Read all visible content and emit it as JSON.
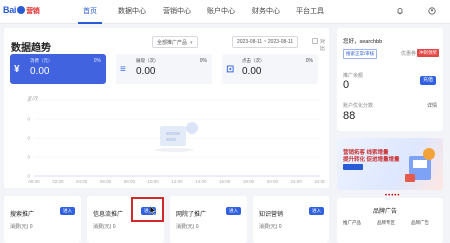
{
  "brand": {
    "logo_text": "Bai",
    "logo_suffix": "营销"
  },
  "nav": {
    "items": [
      "首页",
      "数据中心",
      "营销中心",
      "账户中心",
      "财务中心",
      "平台工具"
    ],
    "active_index": 0
  },
  "trend": {
    "title": "数据趋势",
    "filter": "全部推广产品",
    "date_range": "2023-08-11 ~ 2023-08-11",
    "compare": "对比",
    "metrics": [
      {
        "icon": "¥",
        "label": "消费（元）",
        "value": "0.00",
        "change": "0%",
        "active": true
      },
      {
        "icon": "≡",
        "label": "展现（次）",
        "value": "0.00",
        "change": "0%",
        "active": false
      },
      {
        "icon": "⊡",
        "label": "点击（次）",
        "value": "0.00",
        "change": "0%",
        "active": false
      }
    ],
    "y_unit": "元/次"
  },
  "chart_data": {
    "type": "line",
    "x": [
      "00:00",
      "02:00",
      "04:00",
      "06:00",
      "08:00",
      "10:00",
      "12:00",
      "14:00",
      "16:00",
      "18:00",
      "20:00",
      "22:00",
      "24:00"
    ],
    "series": [
      {
        "values": [
          0,
          0,
          0,
          0,
          0,
          0,
          0,
          0,
          0,
          0,
          0,
          0,
          0
        ]
      }
    ],
    "y_ticks": [
      "0",
      "0",
      "0",
      "0",
      "0"
    ],
    "ylim": [
      0,
      1
    ],
    "grid": true,
    "empty_state": true
  },
  "account": {
    "greeting": "您好，searchbb",
    "tag1": "搜索正常/审核",
    "tag2": "优惠券",
    "tag3": "冲刺领奖",
    "balance_label": "推广余额",
    "balance_value": "0",
    "recharge_btn": "充值",
    "score_label": "账户优化分数",
    "score_link": "详情",
    "score_value": "88"
  },
  "banner": {
    "line1": "营销拓客 线索增量",
    "line2": "提升转化 促进增量增量",
    "dots": "•••••"
  },
  "products": [
    {
      "name": "搜索推广",
      "button": "进入",
      "stat_label": "消费(元)",
      "stat_value": "0"
    },
    {
      "name": "信息流推广",
      "button": "进入",
      "stat_label": "消费(元)",
      "stat_value": "0"
    },
    {
      "name": "网院了推广",
      "button": "进入",
      "stat_label": "消费(元)",
      "stat_value": "0"
    },
    {
      "name": "知识营销",
      "button": "进入",
      "stat_label": "消费(元)",
      "stat_value": "0"
    }
  ],
  "brand_ad": {
    "title": "品牌广告",
    "tabs": [
      "推广产品",
      "品牌专区",
      "品牌广告"
    ]
  },
  "colors": {
    "accent": "#4163e0",
    "highlight": "#d22a2a"
  }
}
